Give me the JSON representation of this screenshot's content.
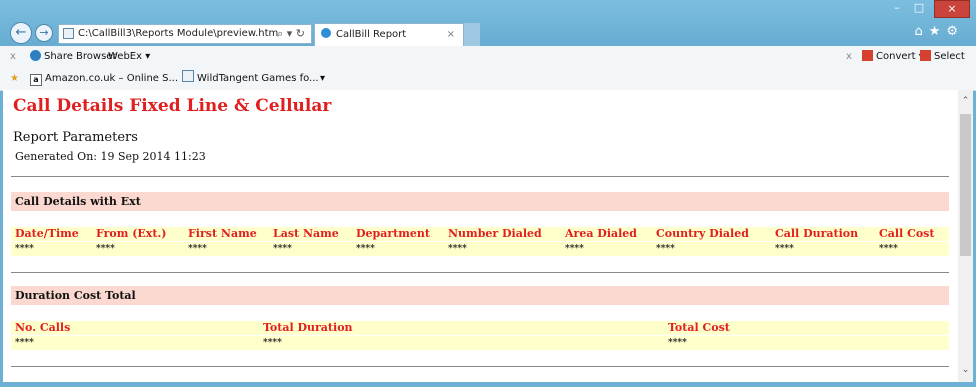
{
  "browser": {
    "address": "C:\\CallBill3\\Reports Module\\preview.htm",
    "address_tools": "⌕ ▾ ↻",
    "tab_title": "CallBill Report",
    "toolbar1": {
      "close": "x",
      "share": "Share Browser",
      "webex": "WebEx ▾",
      "close2": "x",
      "convert": "Convert ▾",
      "select": "Select"
    },
    "favorites": {
      "amazon": "Amazon.co.uk – Online S...",
      "wildtangent": "WildTangent Games fo...",
      "more": "▾"
    }
  },
  "report": {
    "title": "Call Details Fixed Line & Cellular",
    "params_label": "Report Parameters",
    "generated": "Generated On: 19 Sep 2014 11:23",
    "section1": {
      "title": "Call Details with Ext",
      "columns": [
        "Date/Time",
        "From (Ext.)",
        "First Name",
        "Last Name",
        "Department",
        "Number Dialed",
        "Area Dialed",
        "Country Dialed",
        "Call Duration",
        "Call Cost"
      ],
      "values": [
        "****",
        "****",
        "****",
        "****",
        "****",
        "****",
        "****",
        "****",
        "****",
        "****"
      ]
    },
    "section2": {
      "title": "Duration Cost Total",
      "columns": [
        "No. Calls",
        "Total Duration",
        "Total Cost"
      ],
      "values": [
        "****",
        "****",
        "****"
      ]
    }
  }
}
